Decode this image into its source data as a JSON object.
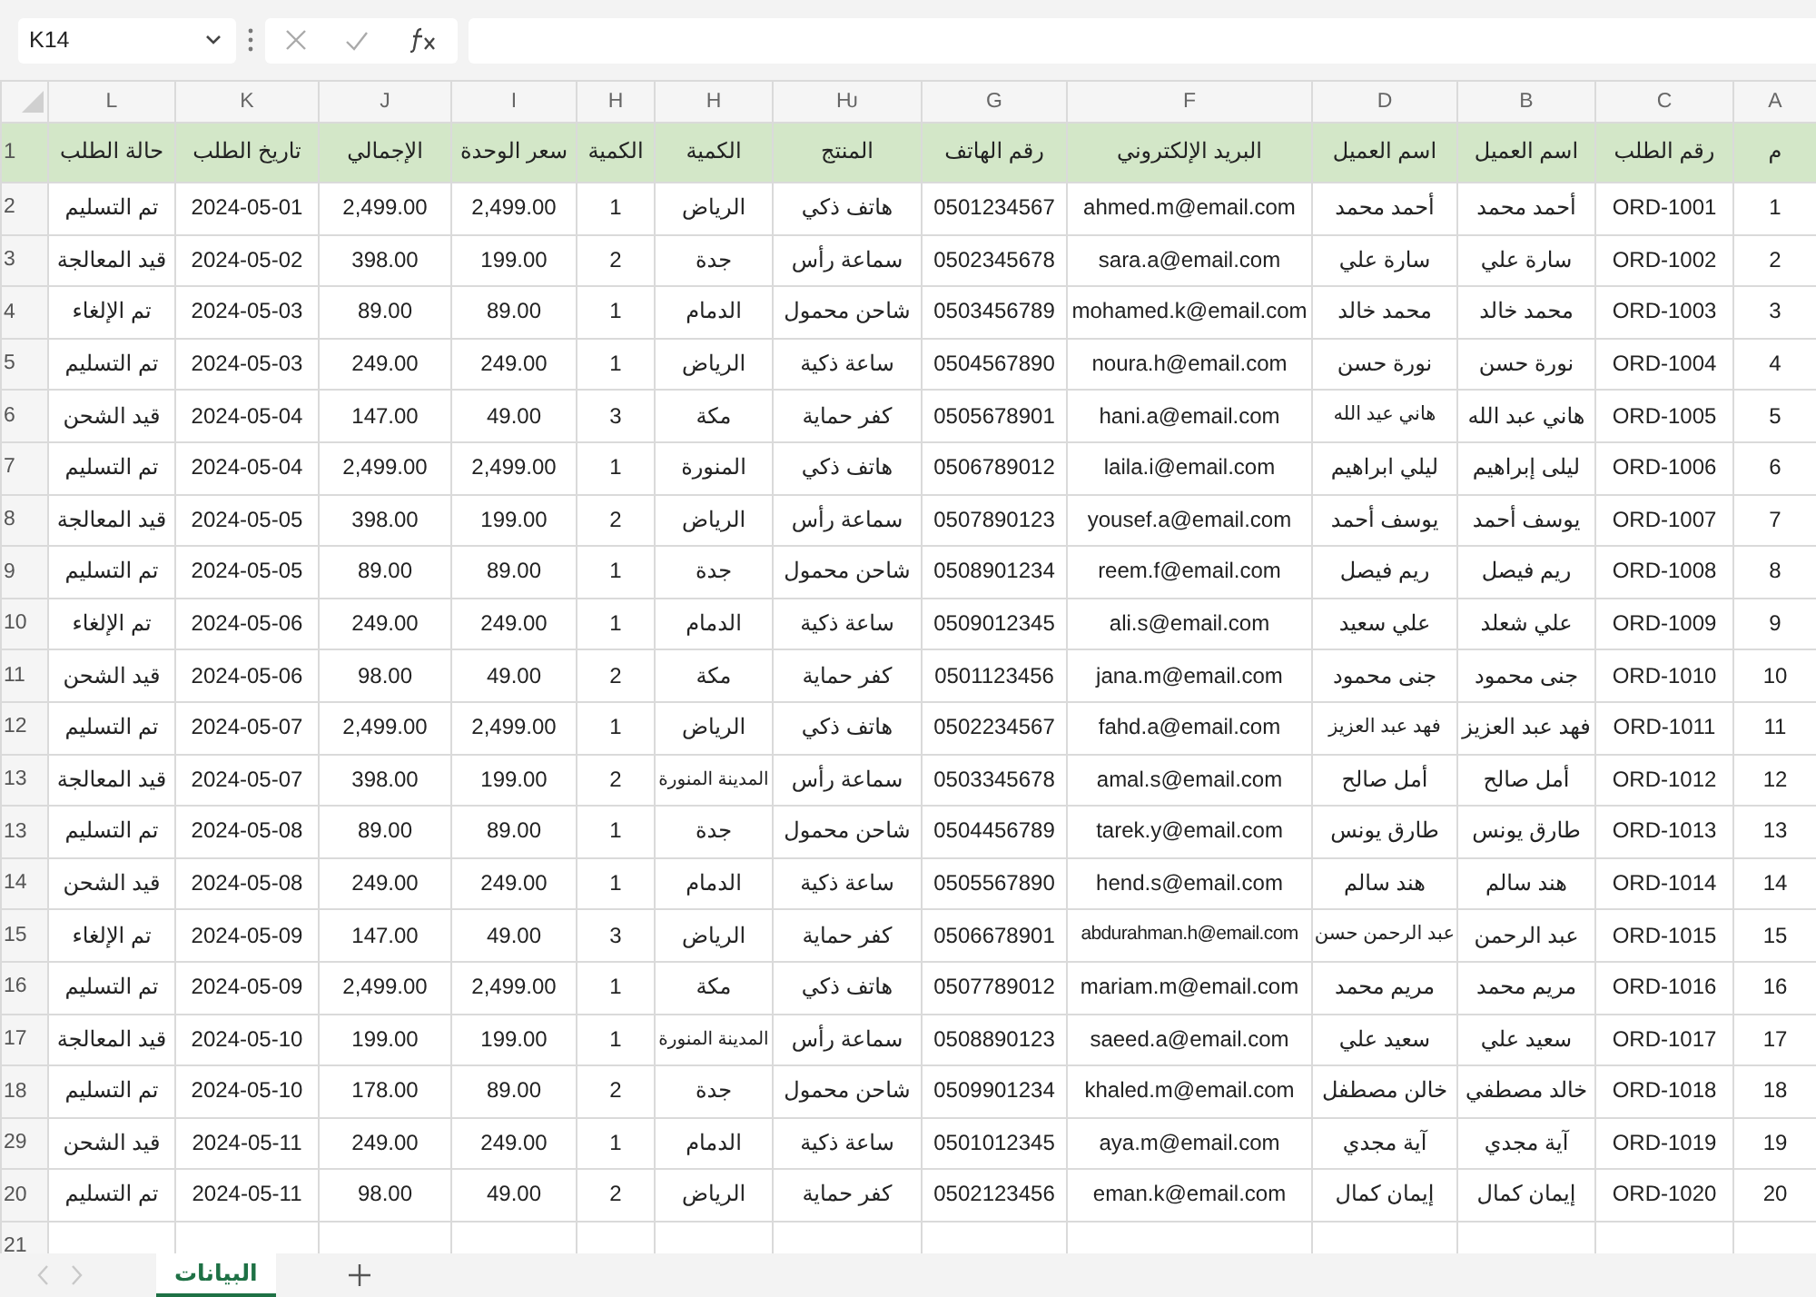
{
  "formula_bar": {
    "name_box": "K14"
  },
  "header_row_number": "1",
  "columns": [
    {
      "letter": "A",
      "header": "م"
    },
    {
      "letter": "C",
      "header": "رقم الطلب"
    },
    {
      "letter": "B",
      "header": "اسم العميل"
    },
    {
      "letter": "D",
      "header": "اسم العميل"
    },
    {
      "letter": "F",
      "header": "البريد الإلكتروني"
    },
    {
      "letter": "G",
      "header": "رقم الهاتف"
    },
    {
      "letter": "Ƕ",
      "header": "المنتج"
    },
    {
      "letter": "H",
      "header": "الكمية"
    },
    {
      "letter": "H",
      "header": "الكمية"
    },
    {
      "letter": "I",
      "header": "سعر الوحدة"
    },
    {
      "letter": "J",
      "header": "الإجمالي"
    },
    {
      "letter": "K",
      "header": "تاريخ الطلب"
    },
    {
      "letter": "L",
      "header": "حالة الطلب"
    }
  ],
  "rows": [
    {
      "number": "2",
      "cells": [
        "1",
        "ORD-1001",
        "أحمد محمد",
        "أحمد محمد",
        "ahmed.m@email.com",
        "0501234567",
        "هاتف ذكي",
        "الرياض",
        "1",
        "2,499.00",
        "2,499.00",
        "2024-05-01",
        "تم التسليم"
      ]
    },
    {
      "number": "3",
      "cells": [
        "2",
        "ORD-1002",
        "سارة علي",
        "سارة علي",
        "sara.a@email.com",
        "0502345678",
        "سماعة رأس",
        "جدة",
        "2",
        "199.00",
        "398.00",
        "2024-05-02",
        "قيد المعالجة"
      ]
    },
    {
      "number": "4",
      "cells": [
        "3",
        "ORD-1003",
        "محمد خالد",
        "محمد خالد",
        "mohamed.k@email.com",
        "0503456789",
        "شاحن محمول",
        "الدمام",
        "1",
        "89.00",
        "89.00",
        "2024-05-03",
        "تم الإلغاء"
      ]
    },
    {
      "number": "5",
      "cells": [
        "4",
        "ORD-1004",
        "نورة حسن",
        "نورة حسن",
        "noura.h@email.com",
        "0504567890",
        "ساعة ذكية",
        "الرياض",
        "1",
        "249.00",
        "249.00",
        "2024-05-03",
        "تم التسليم"
      ]
    },
    {
      "number": "6",
      "cells": [
        "5",
        "ORD-1005",
        "هاني عبد الله",
        "هاني عيد الله",
        "hani.a@email.com",
        "0505678901",
        "كفر حماية",
        "مكة",
        "3",
        "49.00",
        "147.00",
        "2024-05-04",
        "قيد الشحن"
      ]
    },
    {
      "number": "7",
      "cells": [
        "6",
        "ORD-1006",
        "ليلى إبراهيم",
        "ليلي ابراهيم",
        "laila.i@email.com",
        "0506789012",
        "هاتف ذكي",
        "المنورة",
        "1",
        "2,499.00",
        "2,499.00",
        "2024-05-04",
        "تم التسليم"
      ]
    },
    {
      "number": "8",
      "cells": [
        "7",
        "ORD-1007",
        "يوسف أحمد",
        "يوسف أحمد",
        "yousef.a@email.com",
        "0507890123",
        "سماعة رأس",
        "الرياض",
        "2",
        "199.00",
        "398.00",
        "2024-05-05",
        "قيد المعالجة"
      ]
    },
    {
      "number": "9",
      "cells": [
        "8",
        "ORD-1008",
        "ريم فيصل",
        "ريم فيصل",
        "reem.f@email.com",
        "0508901234",
        "شاحن محمول",
        "جدة",
        "1",
        "89.00",
        "89.00",
        "2024-05-05",
        "تم التسليم"
      ]
    },
    {
      "number": "10",
      "cells": [
        "9",
        "ORD-1009",
        "علي شعلد",
        "علي سعيد",
        "ali.s@email.com",
        "0509012345",
        "ساعة ذكية",
        "الدمام",
        "1",
        "249.00",
        "249.00",
        "2024-05-06",
        "تم الإلغاء"
      ]
    },
    {
      "number": "11",
      "cells": [
        "10",
        "ORD-1010",
        "جنى محمود",
        "جنى محمود",
        "jana.m@email.com",
        "0501123456",
        "كفر حماية",
        "مكة",
        "2",
        "49.00",
        "98.00",
        "2024-05-06",
        "قيد الشحن"
      ]
    },
    {
      "number": "12",
      "cells": [
        "11",
        "ORD-1011",
        "فهد عبد العزيز",
        "فهد عبد العزيز",
        "fahd.a@email.com",
        "0502234567",
        "هاتف ذكي",
        "الرياض",
        "1",
        "2,499.00",
        "2,499.00",
        "2024-05-07",
        "تم التسليم"
      ]
    },
    {
      "number": "13",
      "cells": [
        "12",
        "ORD-1012",
        "أمل صالح",
        "أمل صالح",
        "amal.s@email.com",
        "0503345678",
        "سماعة رأس",
        "المدينة المنورة",
        "2",
        "199.00",
        "398.00",
        "2024-05-07",
        "قيد المعالجة"
      ]
    },
    {
      "number": "13",
      "cells": [
        "13",
        "ORD-1013",
        "طارق يونس",
        "طارق يونس",
        "tarek.y@email.com",
        "0504456789",
        "شاحن محمول",
        "جدة",
        "1",
        "89.00",
        "89.00",
        "2024-05-08",
        "تم التسليم"
      ]
    },
    {
      "number": "14",
      "cells": [
        "14",
        "ORD-1014",
        "هند سالم",
        "هند سالم",
        "hend.s@email.com",
        "0505567890",
        "ساعة ذكية",
        "الدمام",
        "1",
        "249.00",
        "249.00",
        "2024-05-08",
        "قيد الشحن"
      ]
    },
    {
      "number": "15",
      "cells": [
        "15",
        "ORD-1015",
        "عبد الرحمن",
        "عبد الرحمن حسن",
        "abdurahman.h@email.com",
        "0506678901",
        "كفر حماية",
        "الرياض",
        "3",
        "49.00",
        "147.00",
        "2024-05-09",
        "تم الإلغاء"
      ]
    },
    {
      "number": "16",
      "cells": [
        "16",
        "ORD-1016",
        "مريم محمد",
        "مريم محمد",
        "mariam.m@email.com",
        "0507789012",
        "هاتف ذكي",
        "مكة",
        "1",
        "2,499.00",
        "2,499.00",
        "2024-05-09",
        "تم التسليم"
      ]
    },
    {
      "number": "17",
      "cells": [
        "17",
        "ORD-1017",
        "سعيد علي",
        "سعيد علي",
        "saeed.a@email.com",
        "0508890123",
        "سماعة رأس",
        "المدينة المنورة",
        "1",
        "199.00",
        "199.00",
        "2024-05-10",
        "قيد المعالجة"
      ]
    },
    {
      "number": "18",
      "cells": [
        "18",
        "ORD-1018",
        "خالد مصطفي",
        "خالن مصطفل",
        "khaled.m@email.com",
        "0509901234",
        "شاحن محمول",
        "جدة",
        "2",
        "89.00",
        "178.00",
        "2024-05-10",
        "تم التسليم"
      ]
    },
    {
      "number": "29",
      "cells": [
        "19",
        "ORD-1019",
        "آية مجدي",
        "آية مجدي",
        "aya.m@email.com",
        "0501012345",
        "ساعة ذكية",
        "الدمام",
        "1",
        "249.00",
        "249.00",
        "2024-05-11",
        "قيد الشحن"
      ]
    },
    {
      "number": "20",
      "cells": [
        "20",
        "ORD-1020",
        "إيمان كمال",
        "إيمان كمال",
        "eman.k@email.com",
        "0502123456",
        "كفر حماية",
        "الرياض",
        "2",
        "49.00",
        "98.00",
        "2024-05-11",
        "تم التسليم"
      ]
    }
  ],
  "empty_row_number": "21",
  "sheet_tabs": [
    {
      "label": "البيانات",
      "selected": true
    }
  ]
}
